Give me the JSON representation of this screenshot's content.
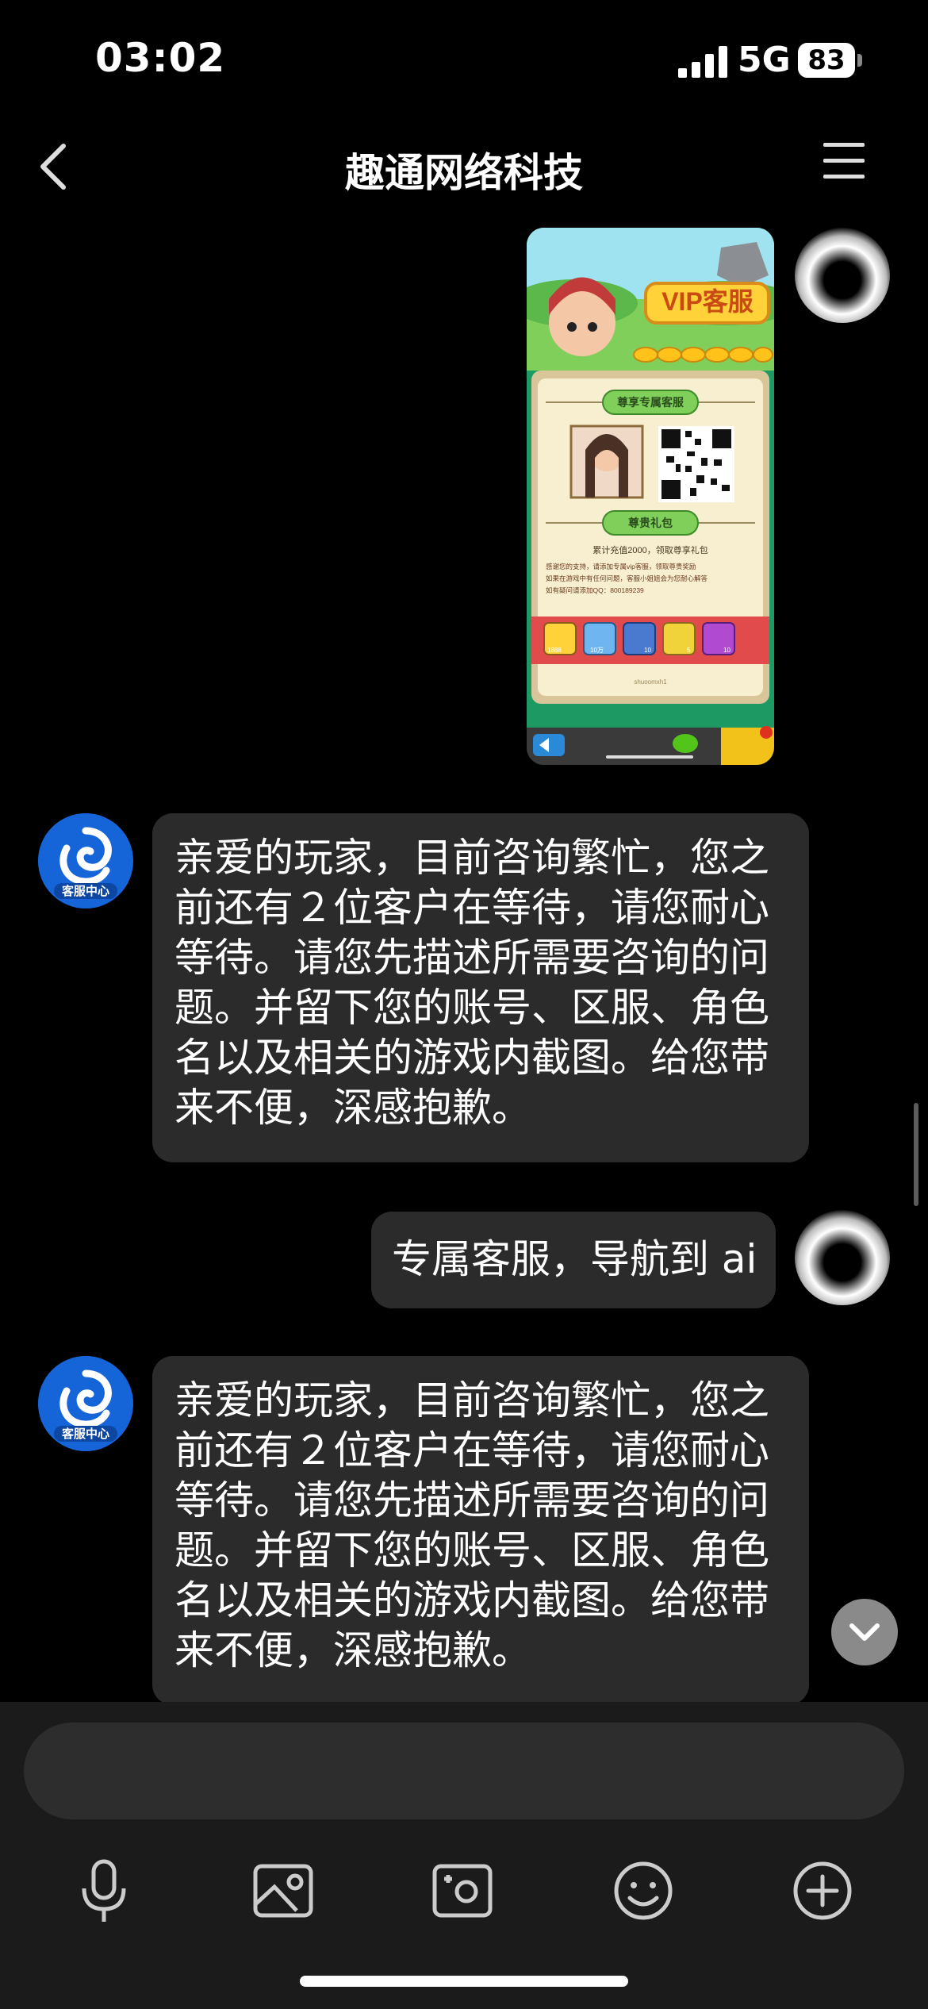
{
  "status": {
    "time": "03:02",
    "network": "5G",
    "battery": "83"
  },
  "header": {
    "title": "趣通网络科技"
  },
  "service_avatar_label": "客服中心",
  "messages": [
    {
      "type": "image",
      "sender": "user",
      "image": {
        "badge_title": "VIP客服",
        "section1": "尊享专属客服",
        "section2": "尊贵礼包",
        "gift_line": "累计充值2000，领取尊享礼包",
        "desc_lines": [
          "感谢您的支持，请添加专属vip客服，领取尊贵奖励",
          "如果在游戏中有任何问题，客服小姐姐会为您耐心解答",
          "如有疑问请添加QQ：800189239"
        ],
        "gift_counts": [
          "1888",
          "10万",
          "10",
          "5",
          "10"
        ],
        "footer": "shuoomxh1"
      }
    },
    {
      "type": "text",
      "sender": "service",
      "text": "亲爱的玩家，目前咨询繁忙，您之前还有２位客户在等待，请您耐心等待。请您先描述所需要咨询的问题。并留下您的账号、区服、角色名以及相关的游戏内截图。给您带来不便，深感抱歉。"
    },
    {
      "type": "text",
      "sender": "user",
      "text": "专属客服，导航到 ai"
    },
    {
      "type": "text",
      "sender": "service",
      "text": "亲爱的玩家，目前咨询繁忙，您之前还有２位客户在等待，请您耐心等待。请您先描述所需要咨询的问题。并留下您的账号、区服、角色名以及相关的游戏内截图。给您带来不便，深感抱歉。"
    }
  ],
  "composer": {
    "value": "",
    "placeholder": ""
  },
  "toolbar": [
    "microphone-icon",
    "image-icon",
    "camera-icon",
    "emoji-icon",
    "plus-icon"
  ],
  "colors": {
    "background": "#000000",
    "bubble": "#2b2b2b",
    "composer": "#1b1b1b",
    "service_brand": "#1565d8"
  }
}
